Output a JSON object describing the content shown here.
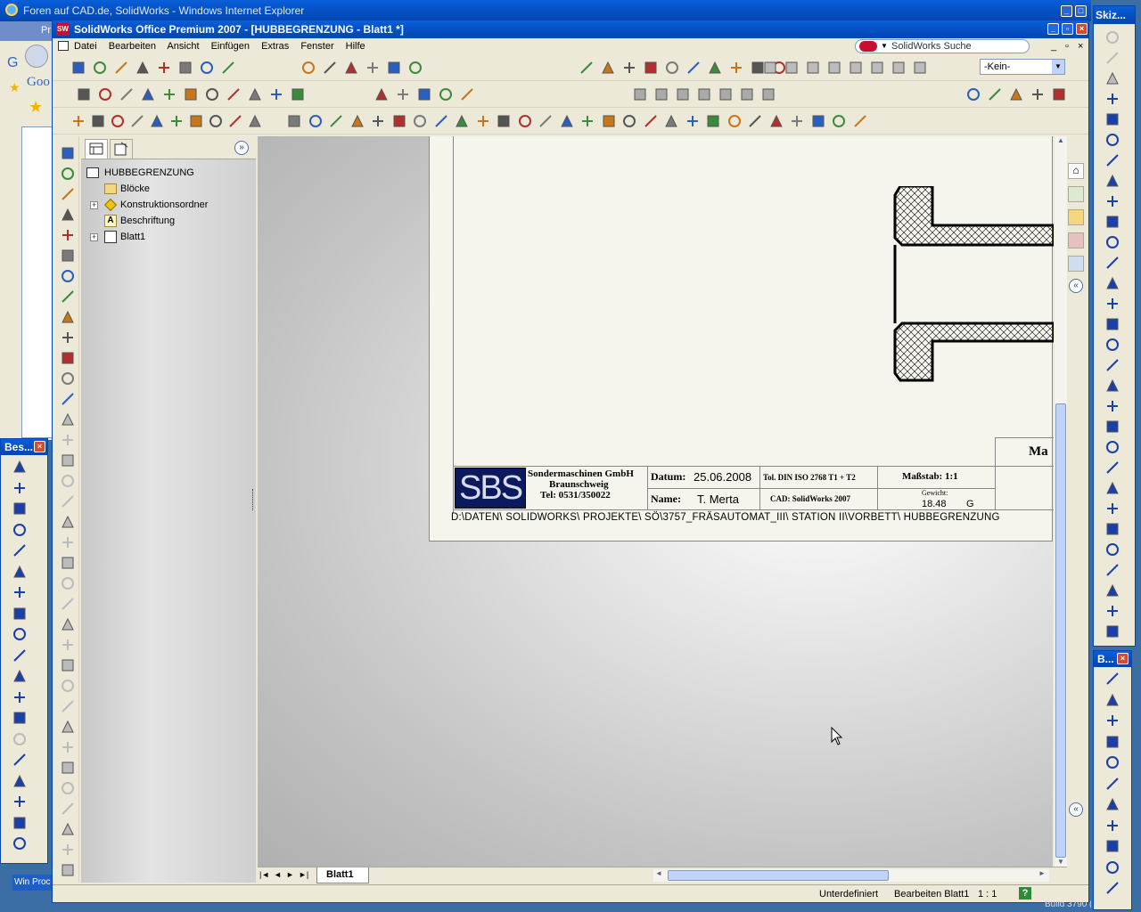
{
  "ie": {
    "title": "Foren auf CAD.de, SolidWorks - Windows Internet Explorer",
    "tab_label": "Pr",
    "google_label": "Goo",
    "side_letter": "G"
  },
  "sw": {
    "title": "SolidWorks Office Premium 2007 - [HUBBEGRENZUNG - Blatt1 *]",
    "menu": [
      "Datei",
      "Bearbeiten",
      "Ansicht",
      "Einfügen",
      "Extras",
      "Fenster",
      "Hilfe"
    ],
    "search_label": "SolidWorks Suche",
    "layer_select": "-Kein-"
  },
  "tree": {
    "root": "HUBBEGRENZUNG",
    "items": [
      "Blöcke",
      "Konstruktionsordner",
      "Beschriftung",
      "Blatt1"
    ]
  },
  "titleblock": {
    "company": "Sondermaschinen GmbH",
    "city": "Braunschweig",
    "tel": "Tel: 0531/350022",
    "logo_text": "SBS",
    "datum_label": "Datum:",
    "datum_value": "25.06.2008",
    "name_label": "Name:",
    "name_value": "T. Merta",
    "tolerance": "Tol. DIN ISO 2768 T1 + T2",
    "cad": "CAD: SolidWorks 2007",
    "scale": "Maßstab: 1:1",
    "weight_label": "Gewicht:",
    "weight_value": "18.48",
    "weight_unit": "G",
    "material_partial": "Ma",
    "path": "D:\\DATEN\\ SOLIDWORKS\\ PROJEKTE\\ SÖ\\3757_FRÄSAUTOMAT_III\\ STATION II\\VORBETT\\ HUBBEGRENZUNG"
  },
  "sheet_tab": "Blatt1",
  "status": {
    "state": "Unterdefiniert",
    "editing": "Bearbeiten Blatt1",
    "scale": "1 : 1",
    "help": "?",
    "build": "Build 3790 (Servi"
  },
  "panels": {
    "skizze_title": "Skiz...",
    "bes_title": "Bes...",
    "b_title": "B...",
    "taskbar_item": "Win Proc"
  },
  "colors": {
    "xp_blue": "#0553c8",
    "canvas_gray": "#b8b8b8",
    "sheet": "#f5f5ee",
    "toolbar": "#ece9d8"
  }
}
